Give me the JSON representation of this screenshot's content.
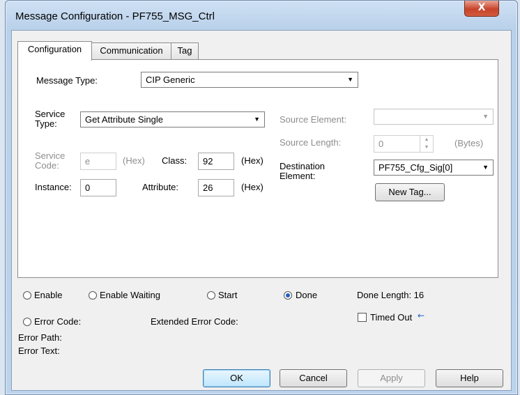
{
  "window": {
    "title": "Message Configuration - PF755_MSG_Ctrl",
    "close_glyph": "X"
  },
  "tabs": [
    {
      "label": "Configuration"
    },
    {
      "label": "Communication"
    },
    {
      "label": "Tag"
    }
  ],
  "config": {
    "message_type_label": "Message Type:",
    "message_type_value": "CIP Generic",
    "service_type_label_1": "Service",
    "service_type_label_2": "Type:",
    "service_type_value": "Get Attribute Single",
    "service_code_label_1": "Service",
    "service_code_label_2": "Code:",
    "service_code_value": "e",
    "hex_label": "(Hex)",
    "class_label": "Class:",
    "class_value": "92",
    "instance_label": "Instance:",
    "instance_value": "0",
    "attribute_label": "Attribute:",
    "attribute_value": "26",
    "source_element_label": "Source Element:",
    "source_element_value": "",
    "source_length_label": "Source Length:",
    "source_length_value": "0",
    "bytes_label": "(Bytes)",
    "destination_label_1": "Destination",
    "destination_label_2": "Element:",
    "destination_value": "PF755_Cfg_Sig[0]",
    "new_tag_label": "New Tag..."
  },
  "status": {
    "enable": "Enable",
    "enable_waiting": "Enable Waiting",
    "start": "Start",
    "done": "Done",
    "done_length": "Done Length: 16",
    "error_code": "Error Code:",
    "extended_error_code": "Extended Error Code:",
    "timed_out": "Timed Out",
    "timed_out_arrow": "←",
    "error_path": "Error Path:",
    "error_text": "Error Text:"
  },
  "buttons": {
    "ok": "OK",
    "cancel": "Cancel",
    "apply": "Apply",
    "help": "Help"
  },
  "colors": {
    "title_bar": "#b9d1ea",
    "close_button": "#c7432a",
    "radio_selected": "#1f5fc4",
    "arrow": "#1f5fc4"
  }
}
